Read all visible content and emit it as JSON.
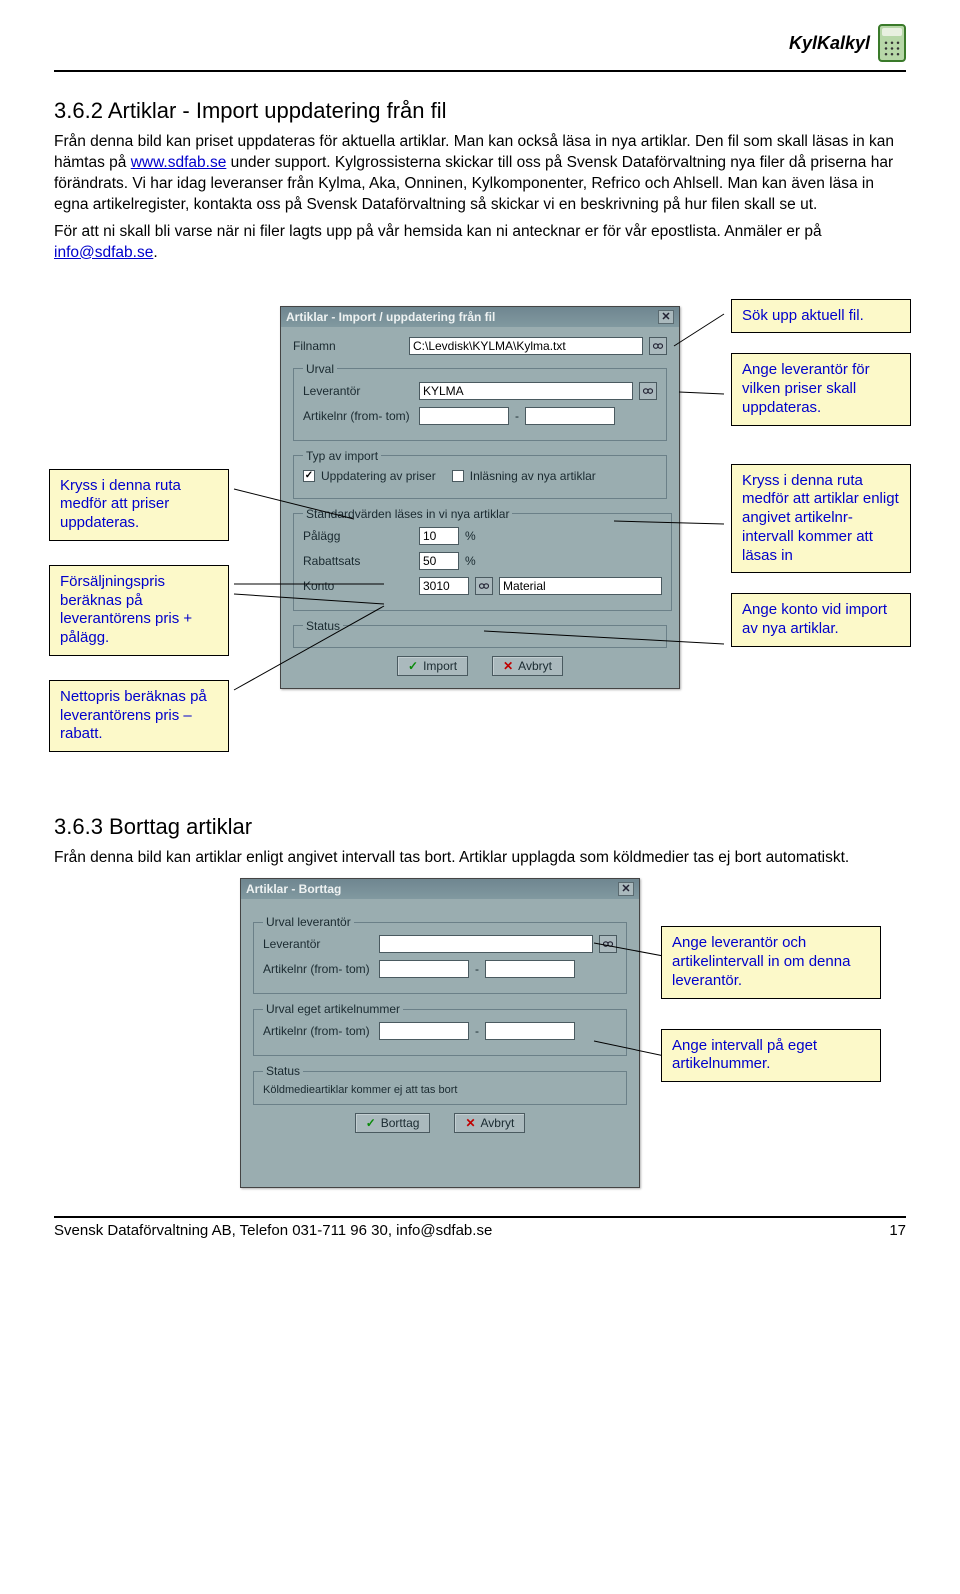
{
  "header": {
    "brand": "KylKalkyl"
  },
  "section1": {
    "title": "3.6.2 Artiklar - Import uppdatering från fil",
    "p1a": "Från denna bild kan priset uppdateras för aktuella artiklar. Man kan också läsa in nya artiklar. Den fil som skall läsas in kan hämtas på ",
    "link1": "www.sdfab.se",
    "p1b": " under support. Kylgrossisterna skickar till oss på Svensk Dataförvaltning nya filer då priserna har förändrats. Vi har idag leveranser från Kylma, Aka, Onninen, Kylkomponenter, Refrico och Ahlsell. Man kan även läsa in egna artikelregister, kontakta oss på Svensk Dataförvaltning så skickar vi en beskrivning på hur filen skall se ut.",
    "p2a": "För att ni skall bli varse när ni filer lagts upp på vår hemsida kan ni antecknar er för vår epostlista. Anmäler er på ",
    "link2": "info@sdfab.se",
    "p2b": "."
  },
  "callouts_left": {
    "c1": "Kryss i denna ruta medför att priser uppdateras.",
    "c2": "Försäljningspris beräknas på leverantörens pris + pålägg.",
    "c3": "Nettopris beräknas på leverantörens pris – rabatt."
  },
  "callouts_right": {
    "c1": "Sök upp aktuell fil.",
    "c2": "Ange leverantör för vilken priser skall uppdateras.",
    "c3": "Kryss i denna ruta medför att artiklar enligt angivet artikelnr-intervall kommer att läsas in",
    "c4": "Ange konto vid import av nya artiklar."
  },
  "win1": {
    "title": "Artiklar - Import / uppdatering från fil",
    "close": "✕",
    "filnamn_lbl": "Filnamn",
    "filnamn_val": "C:\\Levdisk\\KYLMA\\Kylma.txt",
    "urval_legend": "Urval",
    "leverantor_lbl": "Leverantör",
    "leverantor_val": "KYLMA",
    "artnr_lbl": "Artikelnr (from- tom)",
    "dash": "-",
    "typ_legend": "Typ av import",
    "cb1": "Uppdatering av priser",
    "cb2": "Inläsning av nya artiklar",
    "std_legend": "Standardvärden läses in vi nya artiklar",
    "palagg_lbl": "Pålägg",
    "palagg_val": "10",
    "pct": "%",
    "rabatt_lbl": "Rabattsats",
    "rabatt_val": "50",
    "konto_lbl": "Konto",
    "konto_val": "3010",
    "konto_name": "Material",
    "status_legend": "Status",
    "btn_import": "Import",
    "btn_avbryt": "Avbryt"
  },
  "section2": {
    "title": "3.6.3 Borttag artiklar",
    "p": "Från denna bild kan artiklar enligt angivet intervall tas bort. Artiklar upplagda som köldmedier tas ej bort automatiskt."
  },
  "callouts2": {
    "c1": "Ange leverantör och artikelintervall in om denna leverantör.",
    "c2": "Ange intervall på eget artikelnummer."
  },
  "win2": {
    "title": "Artiklar - Borttag",
    "close": "✕",
    "grp1": "Urval leverantör",
    "lev_lbl": "Leverantör",
    "artnr_lbl": "Artikelnr (from- tom)",
    "dash": "-",
    "grp2": "Urval eget artikelnummer",
    "artnr2_lbl": "Artikelnr (from- tom)",
    "status_legend": "Status",
    "status_text": "Köldmedieartiklar kommer ej att tas bort",
    "btn_borttag": "Borttag",
    "btn_avbryt": "Avbryt"
  },
  "footer": {
    "left": "Svensk Dataförvaltning AB, Telefon 031-711 96 30, info@sdfab.se",
    "right": "17"
  }
}
